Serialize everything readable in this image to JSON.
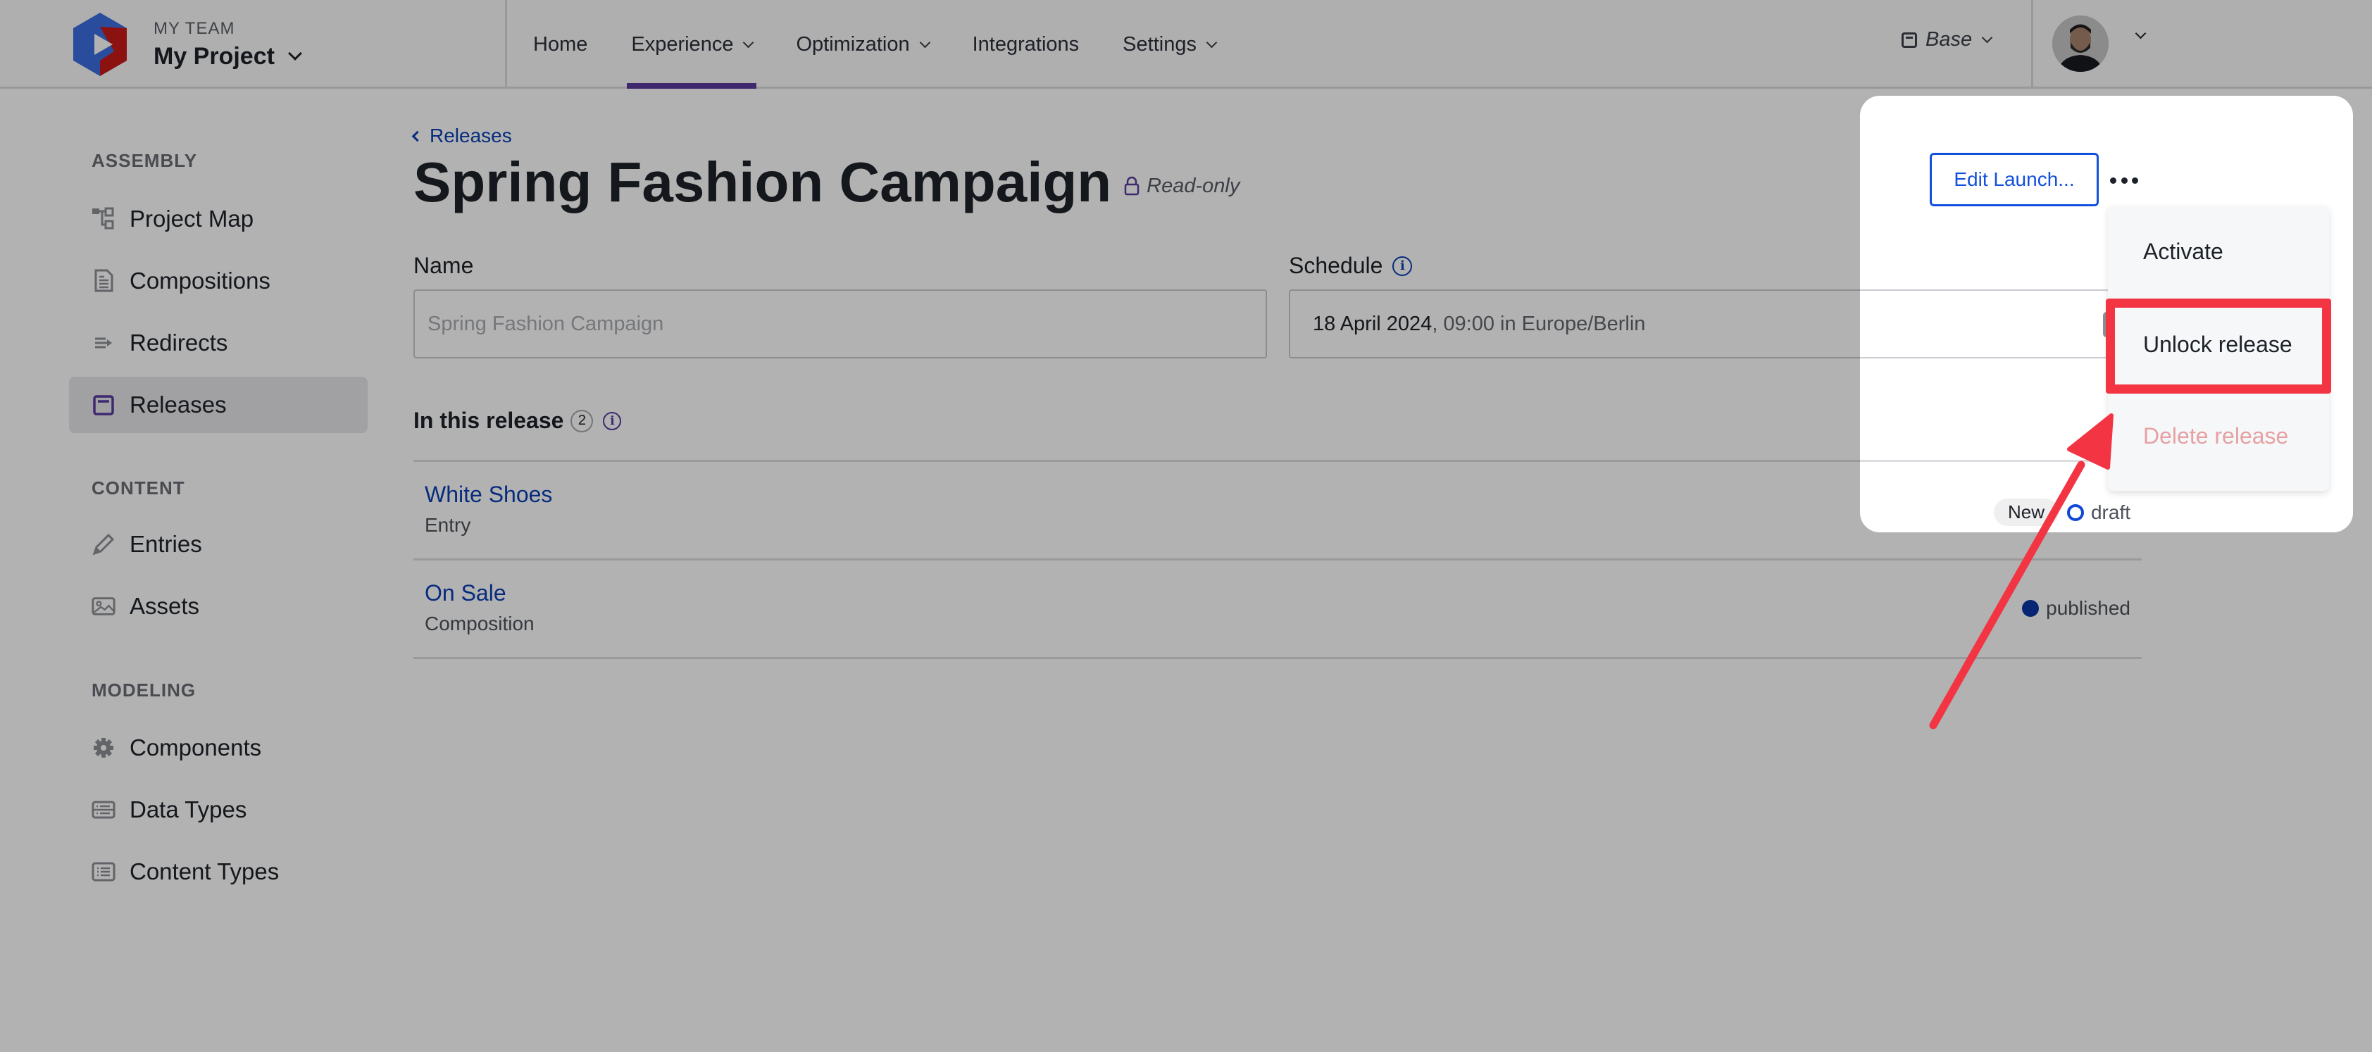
{
  "topbar": {
    "team_label": "MY TEAM",
    "project_name": "My Project",
    "nav": [
      {
        "label": "Home",
        "has_dropdown": false,
        "active": false
      },
      {
        "label": "Experience",
        "has_dropdown": true,
        "active": true
      },
      {
        "label": "Optimization",
        "has_dropdown": true,
        "active": false
      },
      {
        "label": "Integrations",
        "has_dropdown": false,
        "active": false
      },
      {
        "label": "Settings",
        "has_dropdown": true,
        "active": false
      }
    ],
    "environment": "Base",
    "active_color": "#5a3a9e"
  },
  "sidebar": {
    "sections": [
      {
        "title": "ASSEMBLY",
        "items": [
          {
            "label": "Project Map",
            "icon": "sitemap-icon"
          },
          {
            "label": "Compositions",
            "icon": "document-icon"
          },
          {
            "label": "Redirects",
            "icon": "redirect-icon"
          },
          {
            "label": "Releases",
            "icon": "calendar-icon",
            "active": true
          }
        ]
      },
      {
        "title": "CONTENT",
        "items": [
          {
            "label": "Entries",
            "icon": "pencil-icon"
          },
          {
            "label": "Assets",
            "icon": "image-icon"
          }
        ]
      },
      {
        "title": "MODELING",
        "items": [
          {
            "label": "Components",
            "icon": "gear-icon"
          },
          {
            "label": "Data Types",
            "icon": "data-types-icon"
          },
          {
            "label": "Content Types",
            "icon": "list-icon"
          }
        ]
      }
    ]
  },
  "main": {
    "breadcrumb": "Releases",
    "title": "Spring Fashion Campaign",
    "readonly_label": "Read-only",
    "name_field": {
      "label": "Name",
      "placeholder": "Spring Fashion Campaign"
    },
    "schedule_field": {
      "label": "Schedule",
      "date": "18 April 2024",
      "time_suffix": ", 09:00 in Europe/Berlin"
    },
    "release_section": {
      "title": "In this release",
      "count": "2"
    },
    "items": [
      {
        "name": "White Shoes",
        "type": "Entry",
        "badge": "New",
        "status": "draft"
      },
      {
        "name": "On Sale",
        "type": "Composition",
        "badge": "",
        "status": "published"
      }
    ]
  },
  "actions": {
    "edit_label": "Edit Launch...",
    "menu": [
      {
        "label": "Activate",
        "disabled": false
      },
      {
        "label": "Unlock release",
        "disabled": false,
        "highlighted": true
      },
      {
        "label": "Delete release",
        "disabled": true
      }
    ]
  },
  "annotation": {
    "color": "#f23443",
    "target": "Unlock release"
  }
}
